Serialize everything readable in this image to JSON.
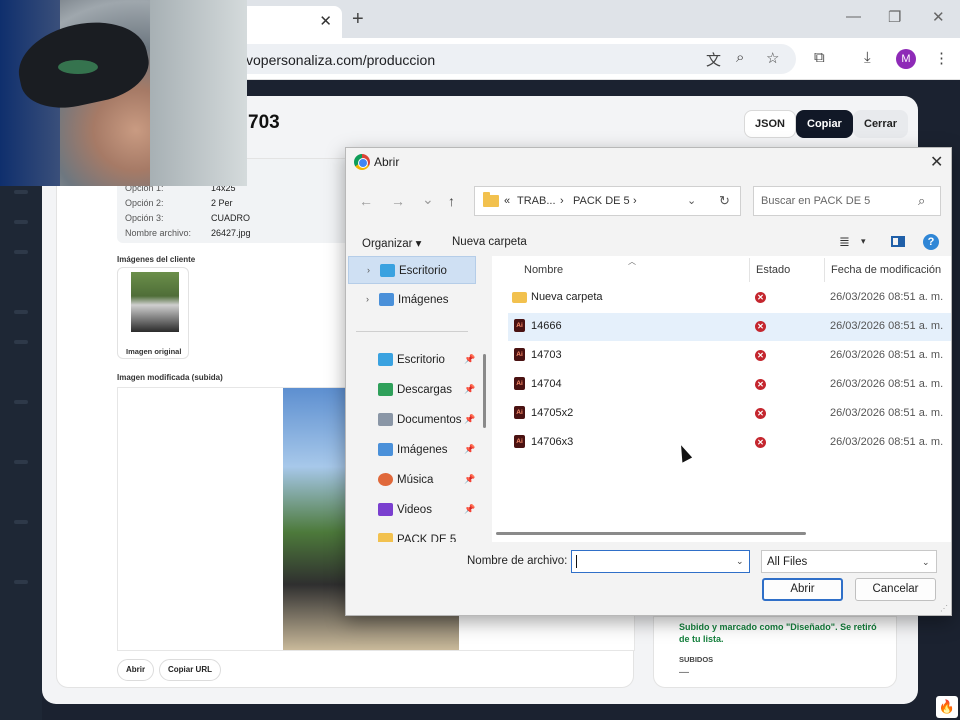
{
  "browser": {
    "url": "vopersonaliza.com/produccion",
    "tab_close": "✕",
    "new_tab": "+",
    "win_min": "—",
    "win_restore": "❐",
    "win_close": "✕",
    "avatar_letter": "M"
  },
  "page": {
    "title_fragment": "703",
    "buttons": {
      "json": "JSON",
      "copiar": "Copiar",
      "cerrar": "Cerrar"
    },
    "details": [
      {
        "label": "Opción 1:",
        "value": "14x25"
      },
      {
        "label": "Opción 2:",
        "value": "2 Per"
      },
      {
        "label": "Opción 3:",
        "value": "CUADRO"
      },
      {
        "label": "Nombre archivo:",
        "value": "26427.jpg"
      }
    ],
    "client_images_title": "Imágenes del cliente",
    "original_image_label": "Imagen original",
    "modified_image_title": "Imagen modificada (subida)",
    "actions": {
      "abrir": "Abrir",
      "copiar_url": "Copiar URL"
    },
    "status_message": "Subido y marcado como \"Diseñado\". Se retiró de tu lista.",
    "subidos_label": "SUBIDOS",
    "subidos_value": "—"
  },
  "dialog": {
    "title": "Abrir",
    "close": "✕",
    "nav": {
      "back": "←",
      "forward": "→",
      "recent": "⌄",
      "up": "↑"
    },
    "address": {
      "prefix": "«",
      "crumb1": "TRAB...",
      "sep": "›",
      "crumb2": "PACK DE 5",
      "sep2": "›",
      "dropdown": "⌄",
      "refresh": "↻"
    },
    "search_placeholder": "Buscar en PACK DE 5",
    "toolbar": {
      "organizar": "Organizar ▾",
      "nueva_carpeta": "Nueva carpeta",
      "view": "≣",
      "view_dd": "▾",
      "help": "?"
    },
    "nav_pane": [
      {
        "label": "Escritorio",
        "chevron": "›",
        "color": "#3aa2e0",
        "selected": true
      },
      {
        "label": "Imágenes",
        "chevron": "›",
        "color": "#4a90d9",
        "selected": false
      }
    ],
    "quick_access": [
      {
        "label": "Escritorio",
        "color": "#3aa2e0",
        "pin": "📌"
      },
      {
        "label": "Descargas",
        "color": "#2fa05a",
        "pin": "📌"
      },
      {
        "label": "Documentos",
        "color": "#8a96a6",
        "pin": "📌"
      },
      {
        "label": "Imágenes",
        "color": "#4a90d9",
        "pin": "📌"
      },
      {
        "label": "Música",
        "color": "#e0683a",
        "pin": "📌"
      },
      {
        "label": "Videos",
        "color": "#7a3fcf",
        "pin": "📌"
      },
      {
        "label": "PACK DE 5",
        "color": "#f2c14e",
        "pin": ""
      }
    ],
    "columns": {
      "name": "Nombre",
      "status": "Estado",
      "date": "Fecha de modificación"
    },
    "files": [
      {
        "name": "Nueva carpeta",
        "type": "folder",
        "status": "✕",
        "date": "26/03/2026 08:51 a. m.",
        "hover": false
      },
      {
        "name": "14666",
        "type": "ai",
        "status": "✕",
        "date": "26/03/2026 08:51 a. m.",
        "hover": true
      },
      {
        "name": "14703",
        "type": "ai",
        "status": "✕",
        "date": "26/03/2026 08:51 a. m.",
        "hover": false
      },
      {
        "name": "14704",
        "type": "ai",
        "status": "✕",
        "date": "26/03/2026 08:51 a. m.",
        "hover": false
      },
      {
        "name": "14705x2",
        "type": "ai",
        "status": "✕",
        "date": "26/03/2026 08:51 a. m.",
        "hover": false
      },
      {
        "name": "14706x3",
        "type": "ai",
        "status": "✕",
        "date": "26/03/2026 08:51 a. m.",
        "hover": false
      }
    ],
    "ai_icon_text": "Ai",
    "filename_label": "Nombre de archivo:",
    "filename_value": "",
    "filter_value": "All Files",
    "dropdown_glyph": "⌄",
    "buttons": {
      "abrir": "Abrir",
      "cancelar": "Cancelar"
    }
  },
  "taskbar": {
    "flame_icon": "🔥"
  }
}
